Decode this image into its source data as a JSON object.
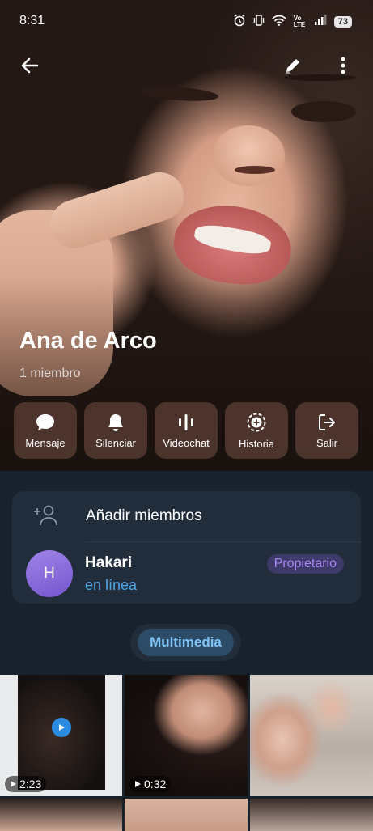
{
  "status_bar": {
    "time": "8:31",
    "network": "Vo LTE",
    "battery": "73"
  },
  "header": {
    "group_name": "Ana de Arco",
    "members_count": "1 miembro"
  },
  "actions": [
    {
      "label": "Mensaje",
      "icon": "chat-bubble-icon"
    },
    {
      "label": "Silenciar",
      "icon": "bell-icon"
    },
    {
      "label": "Videochat",
      "icon": "voice-bars-icon"
    },
    {
      "label": "Historia",
      "icon": "story-add-icon"
    },
    {
      "label": "Salir",
      "icon": "exit-icon"
    }
  ],
  "members_panel": {
    "add_label": "Añadir miembros",
    "member": {
      "initial": "H",
      "name": "Hakari",
      "status": "en línea",
      "role": "Propietario"
    }
  },
  "tabs": {
    "active": "Multimedia"
  },
  "media": [
    {
      "duration": "2:23"
    },
    {
      "duration": "0:32"
    }
  ],
  "colors": {
    "background": "#18222d",
    "panel": "#212d3b",
    "accent_blue": "#4fa6e6",
    "owner_purple": "#a684f2"
  }
}
